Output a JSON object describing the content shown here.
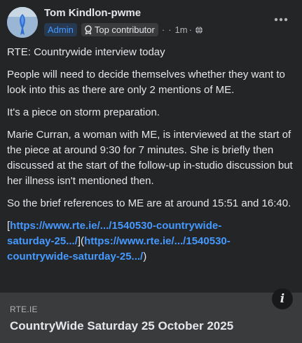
{
  "post": {
    "author": "Tom Kindlon-pwme",
    "avatar_icon": "avatar-image",
    "badges": {
      "admin": "Admin",
      "top_contributor": "Top contributor"
    },
    "separator": "·",
    "time": "1m",
    "privacy_icon": "globe-icon",
    "more_icon": "more-horizontal-icon",
    "paragraphs": [
      "RTE: Countrywide interview today",
      "People will need to decide themselves whether they want to look into this as there are only 2 mentions of ME.",
      "It's a piece on storm preparation.",
      "Marie Curran, a woman with ME, is interviewed at the start of the piece at around 9:30 for 7 minutes. She is briefly then discussed at the start of the follow-up in-studio discussion but her illness isn't mentioned then.",
      "So the brief references to ME are at around 15:51 and 16:40."
    ],
    "links": {
      "open_bracket": "[",
      "link_1_line1": "https://www.rte.ie/.../1540530-countrywide-",
      "link_1_line2": "saturday-25.../",
      "mid": "](",
      "link_2_line1": "https://www.rte.ie/.../1540530-",
      "link_2_line2": "countrywide-saturday-25.../",
      "close": ")"
    }
  },
  "preview": {
    "domain": "RTE.IE",
    "title": "CountryWide Saturday 25 October 2025",
    "info_label": "i"
  },
  "colors": {
    "background": "#242526",
    "text": "#e4e6eb",
    "secondary": "#b0b3b8",
    "link": "#4599ff",
    "admin_badge_bg": "#263951",
    "preview_bg": "#3a3b3c"
  }
}
